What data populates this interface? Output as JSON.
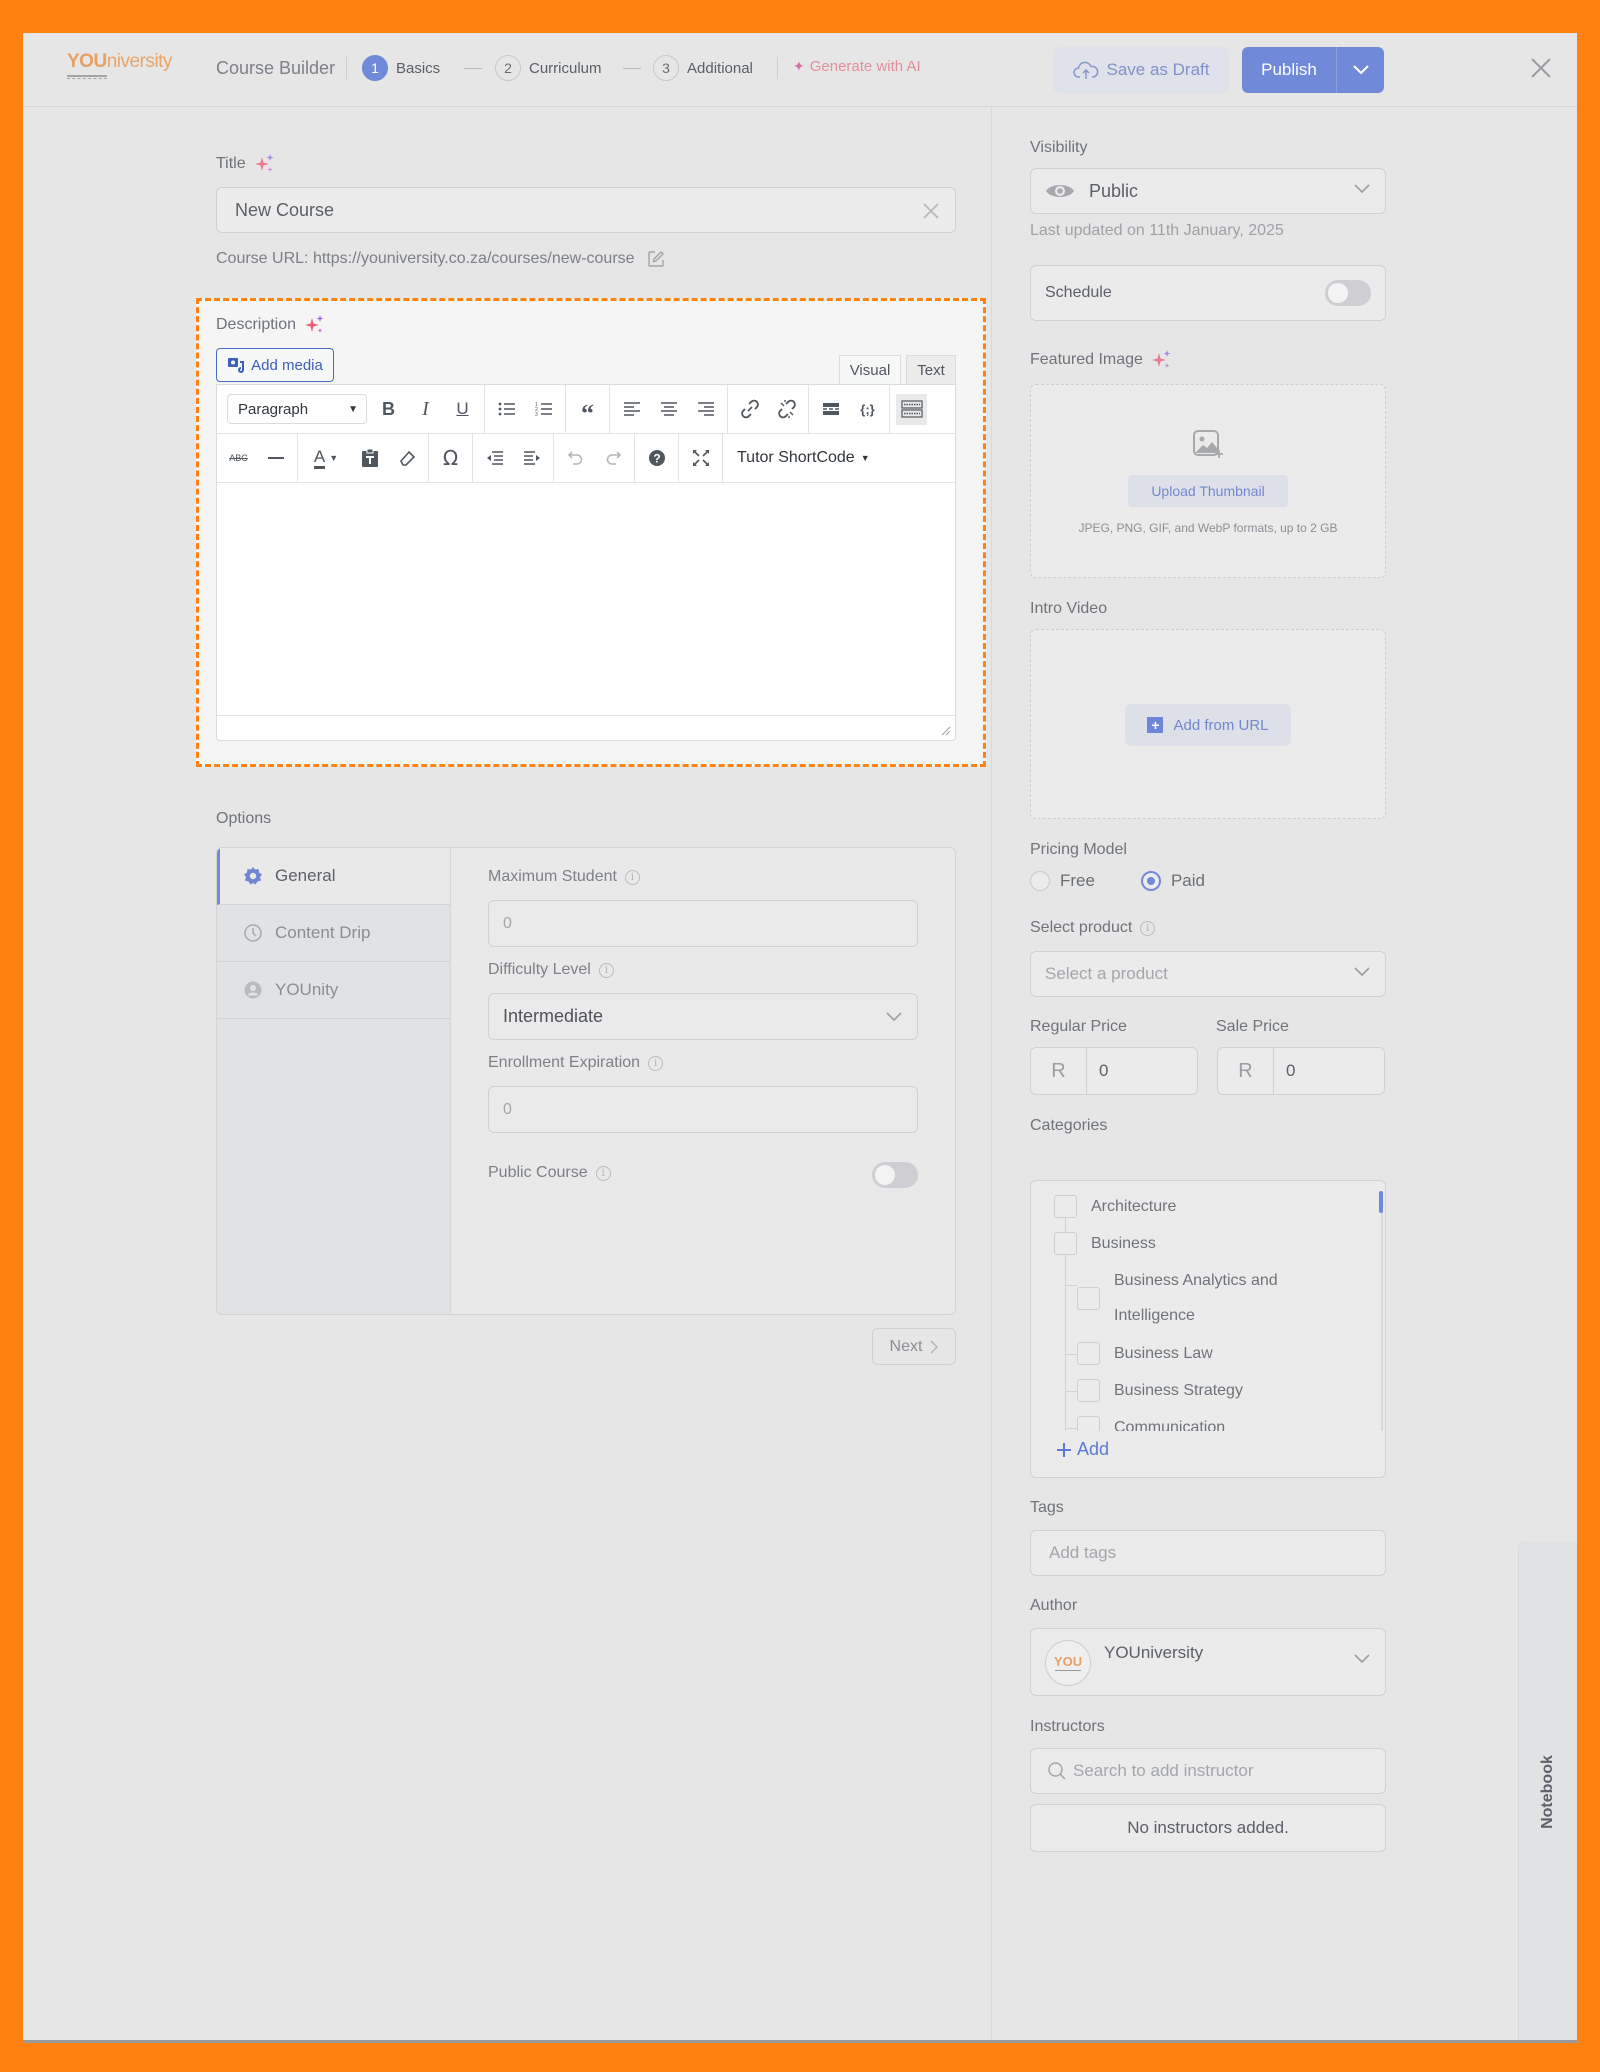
{
  "header": {
    "logo_strong": "YOU",
    "logo_light": "niversity",
    "title": "Course Builder",
    "steps": [
      {
        "num": "1",
        "label": "Basics",
        "active": true
      },
      {
        "num": "2",
        "label": "Curriculum",
        "active": false
      },
      {
        "num": "3",
        "label": "Additional",
        "active": false
      }
    ],
    "generate_ai": "Generate with AI",
    "save_draft": "Save as Draft",
    "publish": "Publish"
  },
  "main": {
    "title_label": "Title",
    "title_value": "New Course",
    "course_url_label": "Course URL:",
    "course_url": "https://youniversity.co.za/courses/new-course",
    "description_label": "Description",
    "add_media": "Add media",
    "editor_tabs": {
      "visual": "Visual",
      "text": "Text"
    },
    "format_select": "Paragraph",
    "shortcode": "Tutor ShortCode",
    "toolbar_row1": [
      "bold",
      "italic",
      "underline",
      "bullet-list",
      "numbered-list",
      "blockquote",
      "align-left",
      "align-center",
      "align-right",
      "insert-link",
      "remove-link",
      "read-more",
      "code",
      "toolbar-toggle"
    ],
    "toolbar_row2": [
      "strikethrough",
      "horizontal-line",
      "text-color",
      "paste-as-text",
      "clear-formatting",
      "special-character",
      "outdent",
      "indent",
      "undo",
      "redo",
      "keyboard-shortcuts",
      "fullscreen"
    ],
    "description_content": "",
    "options_label": "Options",
    "option_tabs": [
      {
        "label": "General",
        "icon": "gear-icon",
        "active": true
      },
      {
        "label": "Content Drip",
        "icon": "clock-icon",
        "active": false
      },
      {
        "label": "YOUnity",
        "icon": "group-icon",
        "active": false
      }
    ],
    "fields": {
      "max_student_label": "Maximum Student",
      "max_student_value": "0",
      "difficulty_label": "Difficulty Level",
      "difficulty_value": "Intermediate",
      "enrollment_label": "Enrollment Expiration",
      "enrollment_value": "0",
      "public_course_label": "Public Course",
      "public_course_on": false
    },
    "next": "Next"
  },
  "sidebar": {
    "visibility_label": "Visibility",
    "visibility_value": "Public",
    "last_updated": "Last updated on 11th January, 2025",
    "schedule_label": "Schedule",
    "schedule_on": false,
    "featured_image_label": "Featured Image",
    "upload_thumbnail": "Upload Thumbnail",
    "formats_note": "JPEG, PNG, GIF, and WebP formats, up to 2 GB",
    "intro_video_label": "Intro Video",
    "add_from_url": "Add from URL",
    "pricing_label": "Pricing Model",
    "pricing_options": [
      {
        "label": "Free",
        "checked": false
      },
      {
        "label": "Paid",
        "checked": true
      }
    ],
    "select_product_label": "Select product",
    "select_product_placeholder": "Select a product",
    "regular_price_label": "Regular Price",
    "sale_price_label": "Sale Price",
    "currency": "R",
    "regular_price": "0",
    "sale_price": "0",
    "categories_label": "Categories",
    "categories": [
      {
        "label": "Architecture",
        "level": 0
      },
      {
        "label": "Business",
        "level": 0
      },
      {
        "label": "Business Analytics and Intelligence",
        "level": 1
      },
      {
        "label": "Business Law",
        "level": 1
      },
      {
        "label": "Business Strategy",
        "level": 1
      },
      {
        "label": "Communication",
        "level": 1
      }
    ],
    "add_category": "Add",
    "tags_label": "Tags",
    "tags_placeholder": "Add tags",
    "author_label": "Author",
    "author_name": "YOUniversity",
    "author_avatar_text": "YOU",
    "instructors_label": "Instructors",
    "instructor_search_placeholder": "Search to add instructor",
    "no_instructors": "No instructors added."
  },
  "notebook_tab": "Notebook",
  "colors": {
    "accent": "#7189d9",
    "brand_orange": "#ff8211",
    "ai_pink": "#e58e9b"
  }
}
